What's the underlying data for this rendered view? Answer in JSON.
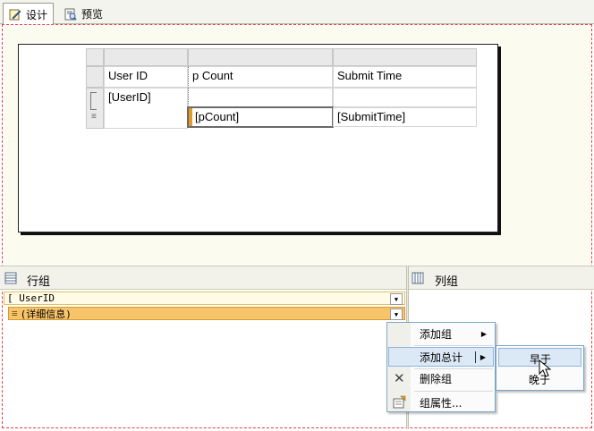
{
  "tabs": [
    {
      "label": "设计",
      "icon": "design-icon",
      "active": true
    },
    {
      "label": "预览",
      "icon": "preview-icon",
      "active": false
    }
  ],
  "tablix": {
    "headers": [
      "User ID",
      "p Count",
      "Submit Time"
    ],
    "group_cell": "[UserID]",
    "detail_cells": [
      "[pCount]",
      "[SubmitTime]"
    ]
  },
  "group_pane": {
    "row_groups_title": "行组",
    "column_groups_title": "列组",
    "row_groups": [
      {
        "label": "[ UserID",
        "icon": "bracket-icon"
      },
      {
        "label": "(详细信息)",
        "icon": "details-lines-icon"
      }
    ]
  },
  "context_menu": {
    "items": [
      {
        "label": "添加组",
        "has_submenu": true
      },
      {
        "label": "添加总计",
        "has_submenu": true
      },
      {
        "label": "删除组",
        "icon": "delete-x-icon"
      },
      {
        "label": "组属性...",
        "icon": "properties-icon"
      }
    ],
    "submenu": [
      "早于",
      "晚于"
    ]
  },
  "colors": {
    "frame_dashed": "#e04040",
    "group_row_selected": "#f8c46a",
    "group_row_top": "#fffbe6",
    "menu_border": "#7ca7c8",
    "highlight": "#dbe8f6"
  }
}
